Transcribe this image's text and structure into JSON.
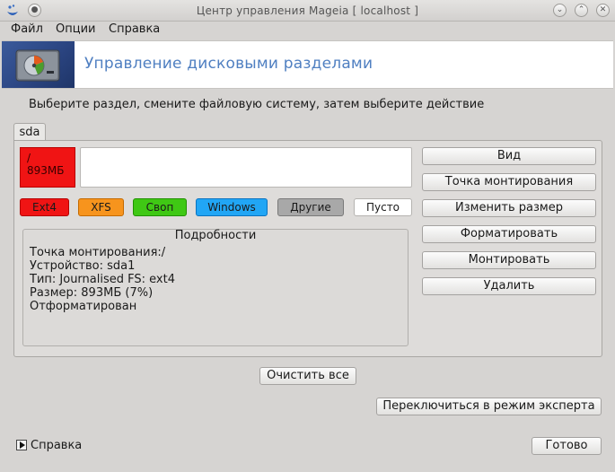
{
  "window": {
    "title": "Центр управления Mageia  [ localhost ]",
    "controls": [
      "minimize-icon",
      "maximize-icon",
      "close-icon"
    ]
  },
  "menu": {
    "items": [
      {
        "label": "Файл"
      },
      {
        "label": "Опции"
      },
      {
        "label": "Справка"
      }
    ]
  },
  "banner": {
    "title": "Управление дисковыми разделами",
    "icon": "disk-partition-icon"
  },
  "instruction": "Выберите раздел, смените файловую систему, затем выберите действие",
  "tabs": [
    {
      "label": "sda"
    }
  ],
  "partitions": [
    {
      "mount": "/",
      "size": "893МБ",
      "color": "#f01414"
    }
  ],
  "legend": [
    {
      "label": "Ext4",
      "bg": "#f01414",
      "border": "#b50000",
      "fg": "#1a1a1a"
    },
    {
      "label": "XFS",
      "bg": "#f7941d",
      "border": "#c46a00",
      "fg": "#1a1a1a"
    },
    {
      "label": "Своп",
      "bg": "#3fc814",
      "border": "#219100",
      "fg": "#1a1a1a"
    },
    {
      "label": "Windows",
      "bg": "#21a6f5",
      "border": "#0a73c0",
      "fg": "#1a1a1a"
    },
    {
      "label": "Другие",
      "bg": "#a8a8a8",
      "border": "#7a7a7a",
      "fg": "#1a1a1a"
    },
    {
      "label": "Пусто",
      "bg": "#ffffff",
      "border": "#b5b3b0",
      "fg": "#1a1a1a"
    }
  ],
  "details": {
    "title": "Подробности",
    "lines": [
      "Точка монтирования:/",
      "Устройство: sda1",
      "Тип: Journalised FS: ext4",
      "Размер: 893МБ (7%)",
      "Отформатирован"
    ]
  },
  "actions": [
    {
      "label": "Вид"
    },
    {
      "label": "Точка монтирования"
    },
    {
      "label": "Изменить размер"
    },
    {
      "label": "Форматировать"
    },
    {
      "label": "Монтировать"
    },
    {
      "label": "Удалить"
    }
  ],
  "bottom": {
    "clear_all": "Очистить все",
    "expert_mode": "Переключиться в режим эксперта",
    "help": "Справка",
    "done": "Готово"
  }
}
